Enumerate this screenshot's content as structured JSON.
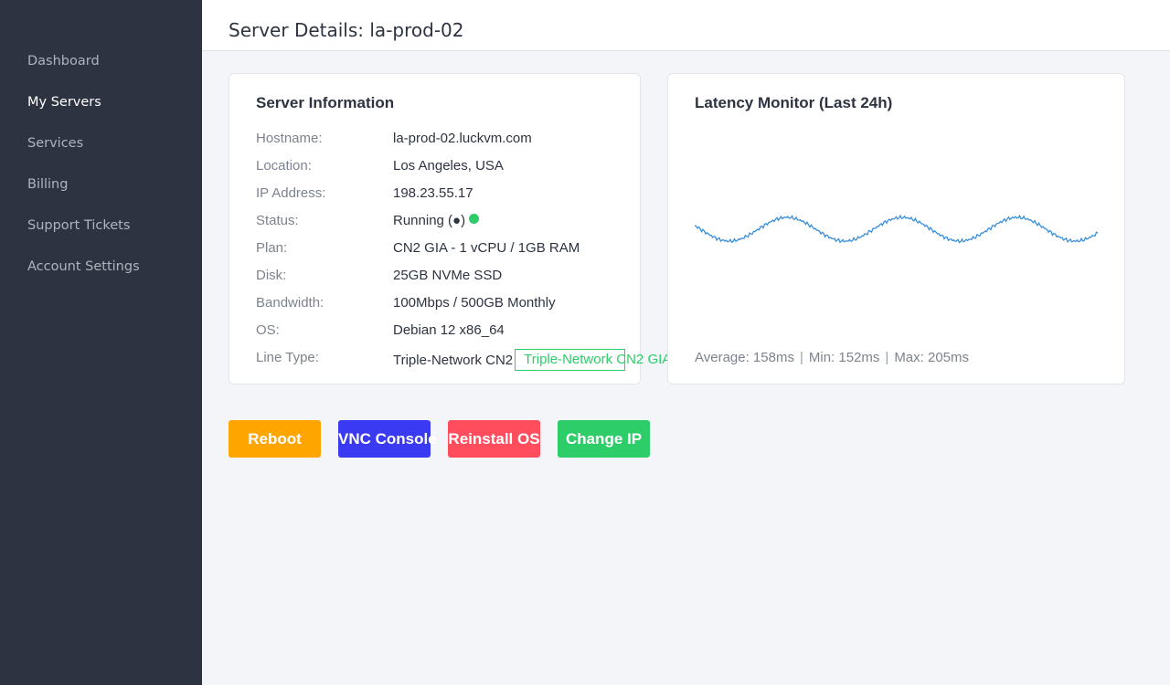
{
  "sidebar": {
    "items": [
      {
        "label": "Dashboard",
        "active": false
      },
      {
        "label": "My Servers",
        "active": true
      },
      {
        "label": "Services",
        "active": false
      },
      {
        "label": "Billing",
        "active": false
      },
      {
        "label": "Support Tickets",
        "active": false
      },
      {
        "label": "Account Settings",
        "active": false
      }
    ]
  },
  "header": {
    "title": "Server Details: la-prod-02"
  },
  "server_info": {
    "title": "Server Information",
    "rows": [
      {
        "label": "Hostname:",
        "value": "la-prod-02.luckvm.com"
      },
      {
        "label": "Location:",
        "value": "Los Angeles, USA"
      },
      {
        "label": "IP Address:",
        "value": "198.23.55.17"
      },
      {
        "label": "Status:",
        "value": "Running (●)"
      },
      {
        "label": "Plan:",
        "value": "CN2 GIA - 1 vCPU / 1GB RAM"
      },
      {
        "label": "Disk:",
        "value": "25GB NVMe SSD"
      },
      {
        "label": "Bandwidth:",
        "value": "100Mbps / 500GB Monthly"
      },
      {
        "label": "OS:",
        "value": "Debian 12 x86_64"
      },
      {
        "label": "Line Type:",
        "value": "Triple-Network CN2"
      }
    ],
    "line_badge": "Triple-Network CN2 GIA",
    "status_color": "#2dce6a"
  },
  "latency": {
    "title": "Latency Monitor (Last 24h)",
    "average": "Average: 158ms",
    "min": "Min: 152ms",
    "max": "Max: 205ms",
    "separator": "|",
    "line_color": "#3a8fd9"
  },
  "actions": [
    {
      "label": "Reboot",
      "color": "#ffa500"
    },
    {
      "label": "VNC Console",
      "color": "#3a3af2"
    },
    {
      "label": "Reinstall OS",
      "color": "#ff4d5e"
    },
    {
      "label": "Change IP",
      "color": "#2dce6a"
    }
  ]
}
